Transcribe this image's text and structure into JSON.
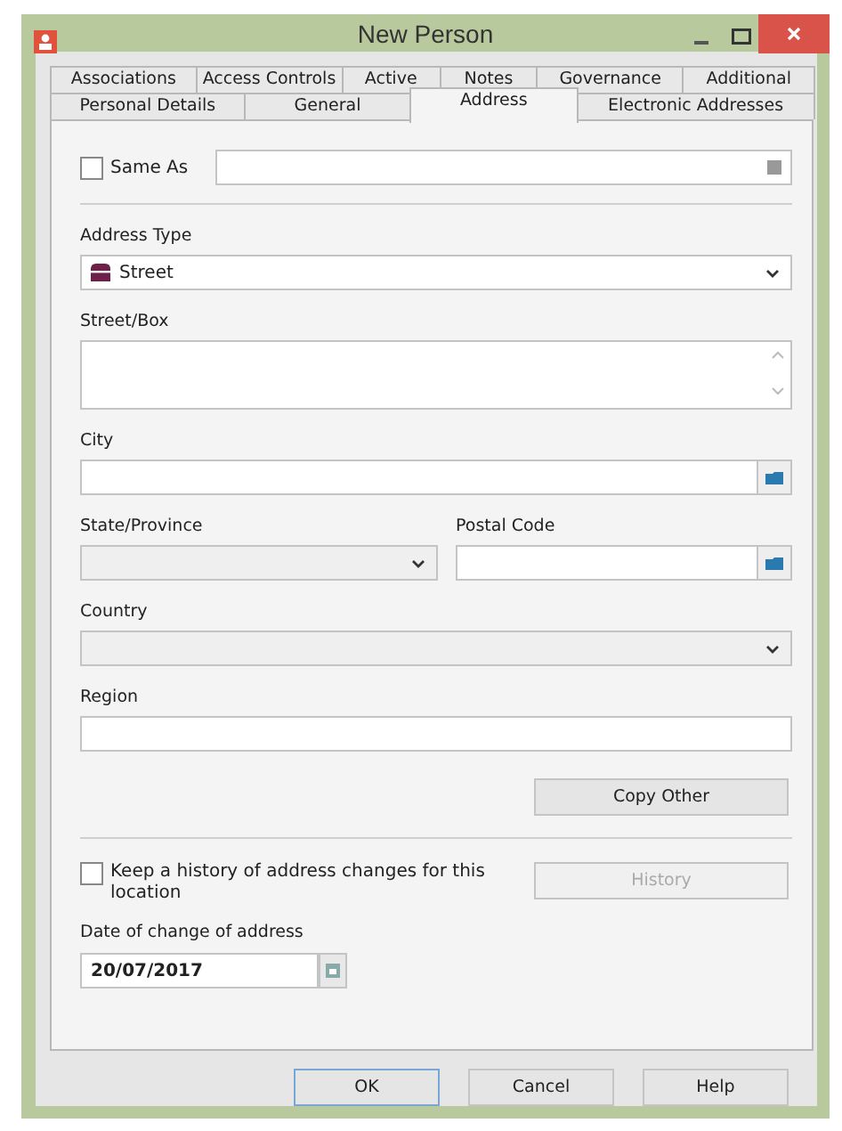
{
  "window": {
    "title": "New Person"
  },
  "tab_rows": [
    [
      {
        "label": "Associations",
        "selected": false
      },
      {
        "label": "Access Controls",
        "selected": false
      },
      {
        "label": "Active",
        "selected": false
      },
      {
        "label": "Notes",
        "selected": false
      },
      {
        "label": "Governance",
        "selected": false
      },
      {
        "label": "Additional",
        "selected": false
      }
    ],
    [
      {
        "label": "Personal Details",
        "selected": false
      },
      {
        "label": "General",
        "selected": false
      },
      {
        "label": "Address",
        "selected": true
      },
      {
        "label": "Electronic Addresses",
        "selected": false
      }
    ]
  ],
  "same_as": {
    "label": "Same As",
    "checked": false
  },
  "address_type": {
    "label": "Address Type",
    "value": "Street"
  },
  "street_box": {
    "label": "Street/Box"
  },
  "city": {
    "label": "City"
  },
  "state_province": {
    "label": "State/Province",
    "disabled": true
  },
  "postal_code": {
    "label": "Postal Code"
  },
  "country": {
    "label": "Country",
    "disabled": true
  },
  "region": {
    "label": "Region"
  },
  "copy_other_button": {
    "label": "Copy Other"
  },
  "history": {
    "label": "Keep a history of address changes for this location",
    "checked": false
  },
  "history_button": {
    "label": "History",
    "disabled": true
  },
  "date_of_change": {
    "label": "Date of change of address",
    "value": "20/07/2017"
  },
  "buttons": [
    {
      "label": "OK",
      "default": true
    },
    {
      "label": "Cancel",
      "default": false
    },
    {
      "label": "Help",
      "default": false
    }
  ]
}
